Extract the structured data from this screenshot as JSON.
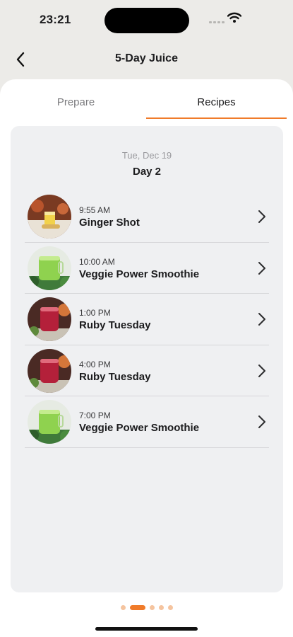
{
  "status_bar": {
    "time": "23:21"
  },
  "nav": {
    "title": "5-Day Juice"
  },
  "tabs": [
    {
      "label": "Prepare",
      "selected": false
    },
    {
      "label": "Recipes",
      "selected": true
    }
  ],
  "day_header": {
    "date": "Tue, Dec 19",
    "day": "Day 2"
  },
  "recipes": [
    {
      "time": "9:55 AM",
      "name": "Ginger Shot",
      "image": "ginger-shot-photo"
    },
    {
      "time": "10:00 AM",
      "name": "Veggie Power Smoothie",
      "image": "green-smoothie-photo"
    },
    {
      "time": "1:00 PM",
      "name": "Ruby Tuesday",
      "image": "red-juice-photo"
    },
    {
      "time": "4:00 PM",
      "name": "Ruby Tuesday",
      "image": "red-juice-photo"
    },
    {
      "time": "7:00 PM",
      "name": "Veggie Power Smoothie",
      "image": "green-smoothie-photo"
    }
  ],
  "pager": {
    "count": 5,
    "active_index": 1
  },
  "colors": {
    "accent": "#f07b2a",
    "card_bg": "#eff0f2",
    "screen_bg": "#ecebe8"
  }
}
